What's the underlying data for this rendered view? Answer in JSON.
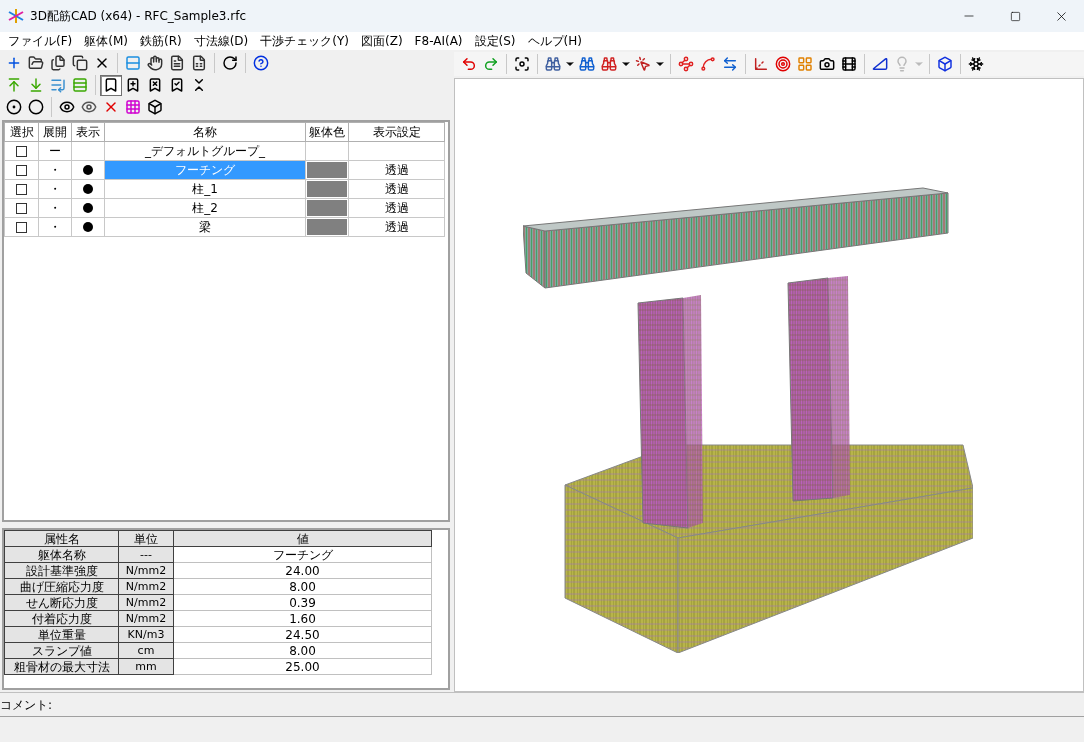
{
  "window": {
    "title": "3D配筋CAD (x64) - RFC_Sample3.rfc"
  },
  "menu": [
    "ファイル(F)",
    "躯体(M)",
    "鉄筋(R)",
    "寸法線(D)",
    "干渉チェック(Y)",
    "図面(Z)",
    "F8-AI(A)",
    "設定(S)",
    "ヘルプ(H)"
  ],
  "left_toolbars": [
    [
      {
        "kind": "add"
      },
      {
        "kind": "open"
      },
      {
        "kind": "copy3d"
      },
      {
        "kind": "copy"
      },
      {
        "kind": "delete"
      },
      {
        "kind": "separator"
      },
      {
        "kind": "rows"
      },
      {
        "kind": "hand"
      },
      {
        "kind": "doc"
      },
      {
        "kind": "csv"
      },
      {
        "kind": "separator"
      },
      {
        "kind": "refresh"
      },
      {
        "kind": "separator"
      },
      {
        "kind": "help"
      }
    ],
    [
      {
        "kind": "up"
      },
      {
        "kind": "down"
      },
      {
        "kind": "list"
      },
      {
        "kind": "bars"
      },
      {
        "kind": "separator"
      },
      {
        "kind": "tag",
        "pressed": true
      },
      {
        "kind": "tag-plus",
        "pressed": false
      },
      {
        "kind": "tag-x",
        "pressed": false
      },
      {
        "kind": "tag-check",
        "pressed": false
      },
      {
        "kind": "collapse",
        "pressed": false
      }
    ],
    [
      {
        "kind": "dot"
      },
      {
        "kind": "ring"
      },
      {
        "kind": "separator"
      },
      {
        "kind": "eye"
      },
      {
        "kind": "eye-outline"
      },
      {
        "kind": "cross"
      },
      {
        "kind": "palette"
      },
      {
        "kind": "cube"
      }
    ]
  ],
  "groups": {
    "columns": [
      "選択",
      "展開",
      "表示",
      "名称",
      "躯体色",
      "表示設定"
    ],
    "rows": [
      {
        "checked": false,
        "expand": "ー",
        "visible": false,
        "name": "_デフォルトグループ_",
        "selected": false
      },
      {
        "checked": false,
        "expand": "・",
        "visible": true,
        "name": "フーチング",
        "color": "#808080",
        "display": "透過",
        "selected": true
      },
      {
        "checked": false,
        "expand": "・",
        "visible": true,
        "name": "柱_1",
        "color": "#808080",
        "display": "透過",
        "selected": false
      },
      {
        "checked": false,
        "expand": "・",
        "visible": true,
        "name": "柱_2",
        "color": "#808080",
        "display": "透過",
        "selected": false
      },
      {
        "checked": false,
        "expand": "・",
        "visible": true,
        "name": "梁",
        "color": "#808080",
        "display": "透過",
        "selected": false
      }
    ]
  },
  "properties": {
    "columns": [
      "属性名",
      "単位",
      "値"
    ],
    "rows": [
      {
        "name": "躯体名称",
        "unit": "---",
        "value": "フーチング"
      },
      {
        "name": "設計基準強度",
        "unit": "N/mm2",
        "value": "24.00"
      },
      {
        "name": "曲げ圧縮応力度",
        "unit": "N/mm2",
        "value": "8.00"
      },
      {
        "name": "せん断応力度",
        "unit": "N/mm2",
        "value": "0.39"
      },
      {
        "name": "付着応力度",
        "unit": "N/mm2",
        "value": "1.60"
      },
      {
        "name": "単位重量",
        "unit": "KN/m3",
        "value": "24.50"
      },
      {
        "name": "スランプ値",
        "unit": "cm",
        "value": "8.00"
      },
      {
        "name": "粗骨材の最大寸法",
        "unit": "mm",
        "value": "25.00"
      }
    ]
  },
  "view_toolbar": [
    {
      "kind": "undo"
    },
    {
      "kind": "redo"
    },
    {
      "kind": "separator"
    },
    {
      "kind": "fit"
    },
    {
      "kind": "separator"
    },
    {
      "kind": "find"
    },
    {
      "kind": "caret"
    },
    {
      "kind": "find-add"
    },
    {
      "kind": "find-remove"
    },
    {
      "kind": "caret"
    },
    {
      "kind": "pick"
    },
    {
      "kind": "caret"
    },
    {
      "kind": "separator"
    },
    {
      "kind": "nodes"
    },
    {
      "kind": "spline"
    },
    {
      "kind": "arrows"
    },
    {
      "kind": "separator"
    },
    {
      "kind": "axes"
    },
    {
      "kind": "target"
    },
    {
      "kind": "colors"
    },
    {
      "kind": "camera"
    },
    {
      "kind": "film"
    },
    {
      "kind": "separator"
    },
    {
      "kind": "ruler"
    },
    {
      "kind": "light",
      "disabled": true
    },
    {
      "kind": "caret",
      "disabled": true
    },
    {
      "kind": "separator"
    },
    {
      "kind": "box"
    },
    {
      "kind": "separator"
    },
    {
      "kind": "snow"
    }
  ],
  "comment": {
    "label": "コメント:"
  }
}
